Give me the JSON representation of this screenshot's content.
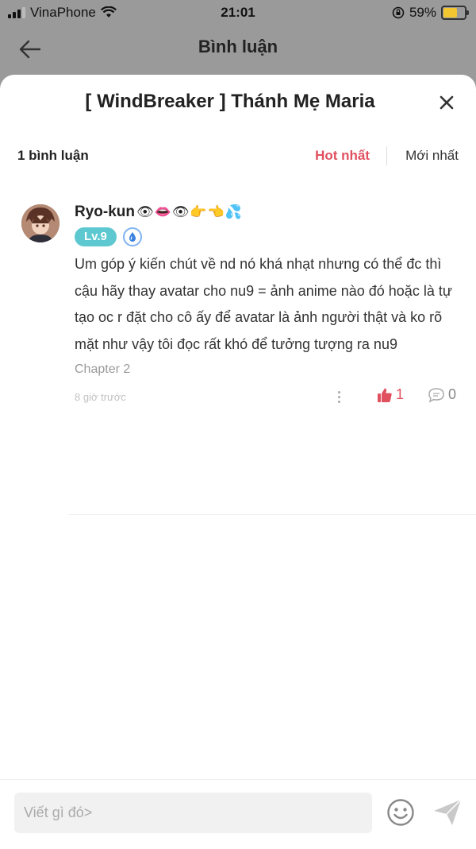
{
  "status_bar": {
    "carrier": "VinaPhone",
    "time": "21:01",
    "battery": "59%",
    "battery_level": 0.59
  },
  "header": {
    "title": "Bình luận"
  },
  "sheet": {
    "title": "[ WindBreaker ] Thánh Mẹ Maria",
    "comment_count": "1 bình luận",
    "sort_hot": "Hot nhất",
    "sort_new": "Mới nhất"
  },
  "comments": [
    {
      "username": "Ryo-kun",
      "emoji": "👁👄👁👉👈💦",
      "level": "Lv.9",
      "text": "Um góp ý kiến chút về nd nó khá nhạt nhưng có thể đc thì cậu hãy thay avatar cho nu9 = ảnh anime nào đó hoặc là tự tạo oc r đặt cho cô ấy để avatar là ảnh người thật và ko rõ mặt như vậy tôi đọc rất khó để tưởng tượng ra nu9",
      "chapter": "Chapter 2",
      "time": "8 giờ trước",
      "likes": "1",
      "replies": "0"
    }
  ],
  "input": {
    "placeholder": "Viết gì đó>"
  },
  "colors": {
    "accent": "#e0505f",
    "level_badge": "#5ec8d1",
    "overlay": "#9a9a9a"
  }
}
